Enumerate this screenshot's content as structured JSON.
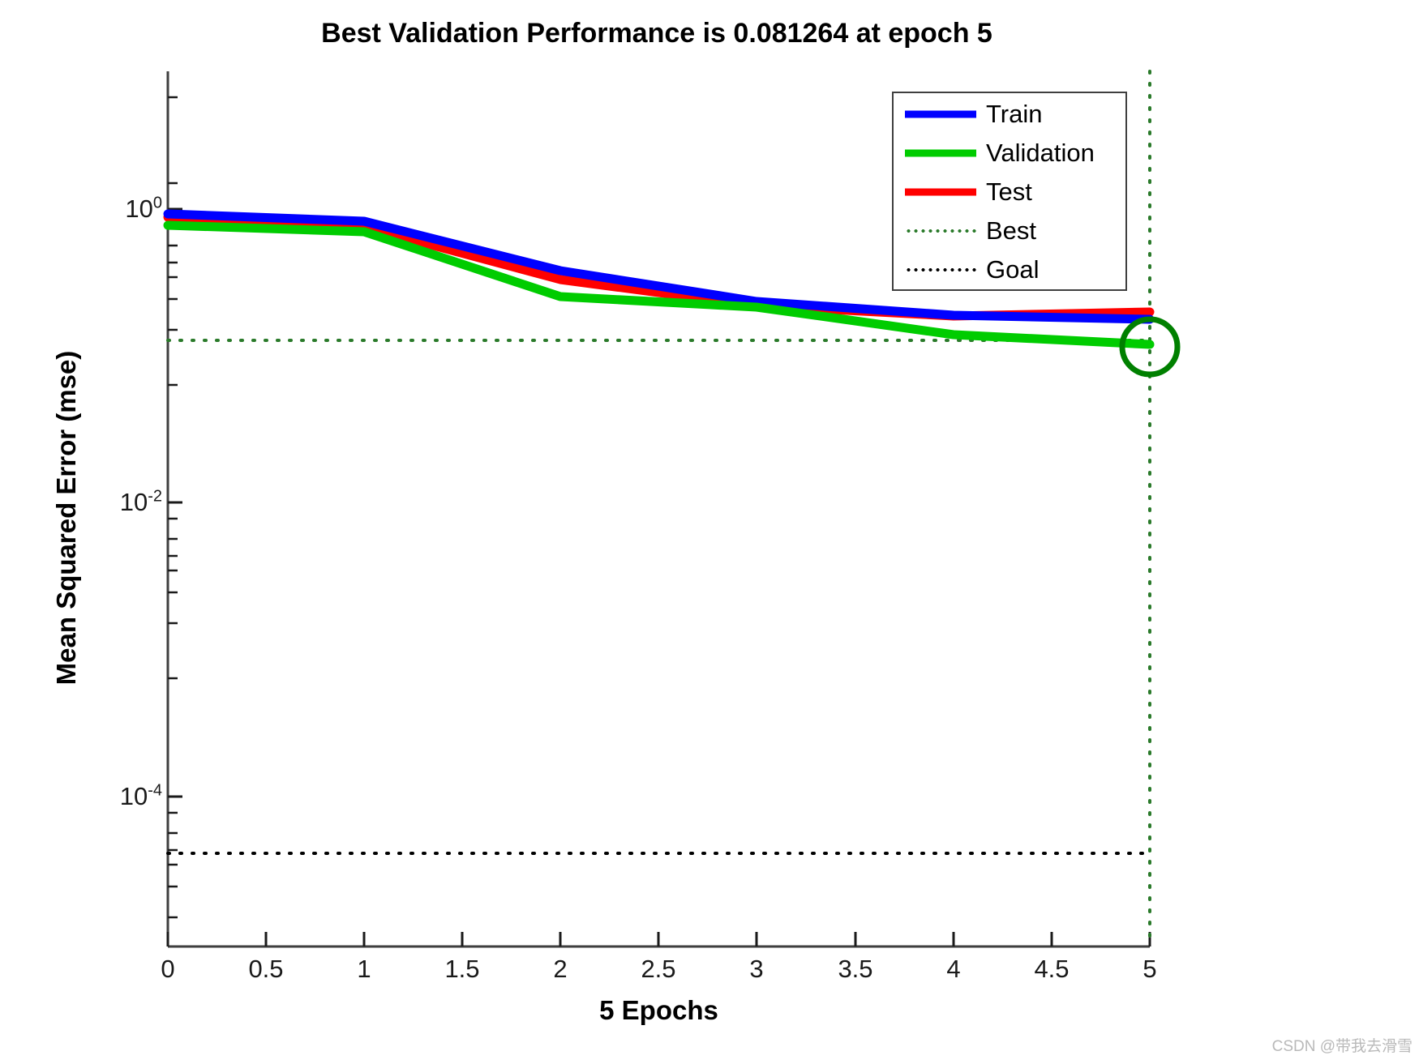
{
  "title": "Best Validation Performance is 0.081264 at epoch 5",
  "axes": {
    "xlabel": "5 Epochs",
    "ylabel": "Mean Squared Error  (mse)",
    "xticks": [
      "0",
      "0.5",
      "1",
      "1.5",
      "2",
      "2.5",
      "3",
      "3.5",
      "4",
      "4.5",
      "5"
    ],
    "yticks": [
      {
        "mantissa": "10",
        "exp": "0"
      },
      {
        "mantissa": "10",
        "exp": "-2"
      },
      {
        "mantissa": "10",
        "exp": "-4"
      }
    ]
  },
  "legend": {
    "items": [
      {
        "label": "Train",
        "color": "#0000ff",
        "style": "solid"
      },
      {
        "label": "Validation",
        "color": "#00cc00",
        "style": "solid"
      },
      {
        "label": "Test",
        "color": "#ff0000",
        "style": "solid"
      },
      {
        "label": "Best",
        "color": "#2a7a2a",
        "style": "dotted"
      },
      {
        "label": "Goal",
        "color": "#000000",
        "style": "dotted"
      }
    ]
  },
  "watermark": "CSDN @带我去滑雪",
  "chart_data": {
    "type": "line",
    "title": "Best Validation Performance is 0.081264 at epoch 5",
    "xlabel": "5 Epochs",
    "ylabel": "Mean Squared Error  (mse)",
    "yscale": "log",
    "xlim": [
      0,
      5
    ],
    "ylim": [
      1e-06,
      4.0
    ],
    "grid": false,
    "legend_position": "top-right",
    "x": [
      0,
      1,
      2,
      3,
      4,
      5
    ],
    "series": [
      {
        "name": "Train",
        "color": "#0000ff",
        "values": [
          1.28,
          1.12,
          0.33,
          0.215,
          0.137,
          0.118
        ]
      },
      {
        "name": "Validation",
        "color": "#00cc00",
        "values": [
          1.07,
          0.94,
          0.21,
          0.175,
          0.0975,
          0.081264
        ]
      },
      {
        "name": "Test",
        "color": "#ff0000",
        "values": [
          1.22,
          1.0,
          0.275,
          0.205,
          0.143,
          0.129
        ]
      }
    ],
    "annotations": [
      {
        "name": "best-marker",
        "type": "circle",
        "x": 5,
        "y": 0.081264,
        "color": "#007700"
      },
      {
        "name": "best-line",
        "type": "hline",
        "y": 0.081264,
        "color": "#2a7a2a",
        "style": "dotted",
        "label": "Best"
      },
      {
        "name": "best-epoch-line",
        "type": "vline",
        "x": 5,
        "color": "#2a7a2a",
        "style": "dotted"
      },
      {
        "name": "goal-line",
        "type": "hline",
        "y": 3.2e-05,
        "color": "#000000",
        "style": "dotted",
        "label": "Goal"
      }
    ],
    "best_value": 0.081264,
    "best_epoch": 5,
    "epochs": 5
  }
}
